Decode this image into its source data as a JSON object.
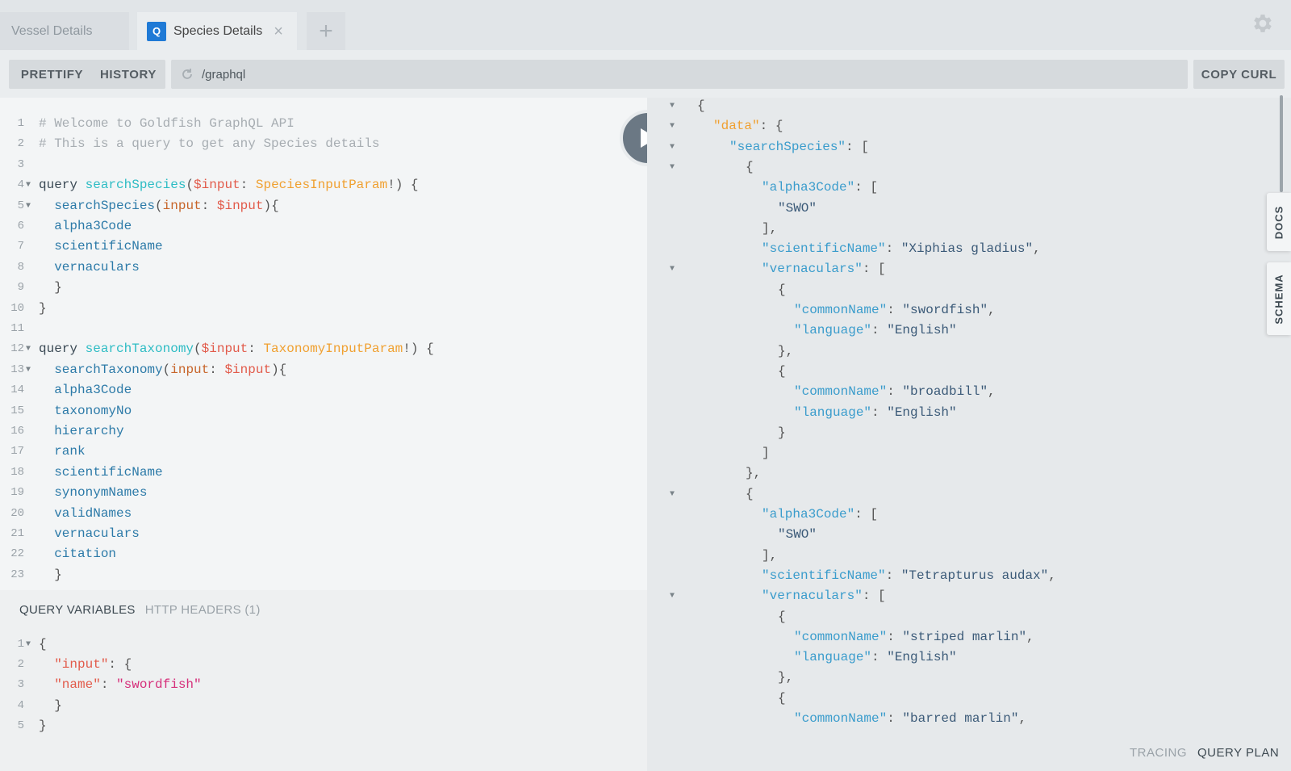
{
  "tabs": [
    {
      "label": "Vessel Details",
      "active": false
    },
    {
      "label": "Species Details",
      "active": true,
      "badge": "Q",
      "close": "×"
    }
  ],
  "tab_add": "+",
  "toolbar": {
    "prettify": "PRETTIFY",
    "history": "HISTORY",
    "url": "/graphql",
    "copy_curl": "COPY CURL"
  },
  "query_lines": [
    [
      {
        "t": "# Welcome to Goldfish GraphQL API",
        "c": "comment"
      }
    ],
    [
      {
        "t": "# This is a query to get any Species details",
        "c": "comment"
      }
    ],
    [],
    [
      {
        "t": "query ",
        "c": "kw"
      },
      {
        "t": "searchSpecies",
        "c": "def"
      },
      {
        "t": "(",
        "c": "punct"
      },
      {
        "t": "$input",
        "c": "var"
      },
      {
        "t": ": ",
        "c": "punct"
      },
      {
        "t": "SpeciesInputParam",
        "c": "type"
      },
      {
        "t": "!) {",
        "c": "punct"
      }
    ],
    [
      {
        "t": "  searchSpecies",
        "c": "field"
      },
      {
        "t": "(",
        "c": "punct"
      },
      {
        "t": "input",
        "c": "arg"
      },
      {
        "t": ": ",
        "c": "punct"
      },
      {
        "t": "$input",
        "c": "var"
      },
      {
        "t": "){",
        "c": "punct"
      }
    ],
    [
      {
        "t": "  alpha3Code",
        "c": "field"
      }
    ],
    [
      {
        "t": "  scientificName",
        "c": "field"
      }
    ],
    [
      {
        "t": "  vernaculars",
        "c": "field"
      }
    ],
    [
      {
        "t": "  }",
        "c": "punct"
      }
    ],
    [
      {
        "t": "}",
        "c": "punct"
      }
    ],
    [],
    [
      {
        "t": "query ",
        "c": "kw"
      },
      {
        "t": "searchTaxonomy",
        "c": "def"
      },
      {
        "t": "(",
        "c": "punct"
      },
      {
        "t": "$input",
        "c": "var"
      },
      {
        "t": ": ",
        "c": "punct"
      },
      {
        "t": "TaxonomyInputParam",
        "c": "type"
      },
      {
        "t": "!) {",
        "c": "punct"
      }
    ],
    [
      {
        "t": "  searchTaxonomy",
        "c": "field"
      },
      {
        "t": "(",
        "c": "punct"
      },
      {
        "t": "input",
        "c": "arg"
      },
      {
        "t": ": ",
        "c": "punct"
      },
      {
        "t": "$input",
        "c": "var"
      },
      {
        "t": "){",
        "c": "punct"
      }
    ],
    [
      {
        "t": "  alpha3Code",
        "c": "field"
      }
    ],
    [
      {
        "t": "  taxonomyNo",
        "c": "field"
      }
    ],
    [
      {
        "t": "  hierarchy",
        "c": "field"
      }
    ],
    [
      {
        "t": "  rank",
        "c": "field"
      }
    ],
    [
      {
        "t": "  scientificName",
        "c": "field"
      }
    ],
    [
      {
        "t": "  synonymNames",
        "c": "field"
      }
    ],
    [
      {
        "t": "  validNames",
        "c": "field"
      }
    ],
    [
      {
        "t": "  vernaculars",
        "c": "field"
      }
    ],
    [
      {
        "t": "  citation",
        "c": "field"
      }
    ],
    [
      {
        "t": "  }",
        "c": "punct"
      }
    ]
  ],
  "query_fold_lines": [
    4,
    5,
    12,
    13
  ],
  "vars_tabs": {
    "query_variables": "QUERY VARIABLES",
    "http_headers": "HTTP HEADERS (1)"
  },
  "var_lines": [
    [
      {
        "t": "{",
        "c": "punct"
      }
    ],
    [
      {
        "t": "  ",
        "c": "punct"
      },
      {
        "t": "\"input\"",
        "c": "key"
      },
      {
        "t": ": {",
        "c": "punct"
      }
    ],
    [
      {
        "t": "  ",
        "c": "punct"
      },
      {
        "t": "\"name\"",
        "c": "key"
      },
      {
        "t": ": ",
        "c": "punct"
      },
      {
        "t": "\"swordfish\"",
        "c": "str"
      }
    ],
    [
      {
        "t": "  }",
        "c": "punct"
      }
    ],
    [
      {
        "t": "}",
        "c": "punct"
      }
    ]
  ],
  "var_fold_lines": [
    1
  ],
  "result_lines": [
    {
      "i": 0,
      "f": true,
      "s": [
        {
          "t": "{",
          "c": "p"
        }
      ]
    },
    {
      "i": 1,
      "f": true,
      "s": [
        {
          "t": "\"data\"",
          "c": "data"
        },
        {
          "t": ": {",
          "c": "p"
        }
      ]
    },
    {
      "i": 2,
      "f": true,
      "s": [
        {
          "t": "\"searchSpecies\"",
          "c": "prop"
        },
        {
          "t": ": [",
          "c": "p"
        }
      ]
    },
    {
      "i": 3,
      "f": true,
      "s": [
        {
          "t": "{",
          "c": "p"
        }
      ]
    },
    {
      "i": 4,
      "f": false,
      "s": [
        {
          "t": "\"alpha3Code\"",
          "c": "prop"
        },
        {
          "t": ": [",
          "c": "p"
        }
      ]
    },
    {
      "i": 5,
      "f": false,
      "s": [
        {
          "t": "\"SWO\"",
          "c": "str"
        }
      ]
    },
    {
      "i": 4,
      "f": false,
      "s": [
        {
          "t": "],",
          "c": "p"
        }
      ]
    },
    {
      "i": 4,
      "f": false,
      "s": [
        {
          "t": "\"scientificName\"",
          "c": "prop"
        },
        {
          "t": ": ",
          "c": "p"
        },
        {
          "t": "\"Xiphias gladius\"",
          "c": "str"
        },
        {
          "t": ",",
          "c": "p"
        }
      ]
    },
    {
      "i": 4,
      "f": true,
      "s": [
        {
          "t": "\"vernaculars\"",
          "c": "prop"
        },
        {
          "t": ": [",
          "c": "p"
        }
      ]
    },
    {
      "i": 5,
      "f": false,
      "s": [
        {
          "t": "{",
          "c": "p"
        }
      ]
    },
    {
      "i": 6,
      "f": false,
      "s": [
        {
          "t": "\"commonName\"",
          "c": "prop"
        },
        {
          "t": ": ",
          "c": "p"
        },
        {
          "t": "\"swordfish\"",
          "c": "str"
        },
        {
          "t": ",",
          "c": "p"
        }
      ]
    },
    {
      "i": 6,
      "f": false,
      "s": [
        {
          "t": "\"language\"",
          "c": "prop"
        },
        {
          "t": ": ",
          "c": "p"
        },
        {
          "t": "\"English\"",
          "c": "str"
        }
      ]
    },
    {
      "i": 5,
      "f": false,
      "s": [
        {
          "t": "},",
          "c": "p"
        }
      ]
    },
    {
      "i": 5,
      "f": false,
      "s": [
        {
          "t": "{",
          "c": "p"
        }
      ]
    },
    {
      "i": 6,
      "f": false,
      "s": [
        {
          "t": "\"commonName\"",
          "c": "prop"
        },
        {
          "t": ": ",
          "c": "p"
        },
        {
          "t": "\"broadbill\"",
          "c": "str"
        },
        {
          "t": ",",
          "c": "p"
        }
      ]
    },
    {
      "i": 6,
      "f": false,
      "s": [
        {
          "t": "\"language\"",
          "c": "prop"
        },
        {
          "t": ": ",
          "c": "p"
        },
        {
          "t": "\"English\"",
          "c": "str"
        }
      ]
    },
    {
      "i": 5,
      "f": false,
      "s": [
        {
          "t": "}",
          "c": "p"
        }
      ]
    },
    {
      "i": 4,
      "f": false,
      "s": [
        {
          "t": "]",
          "c": "p"
        }
      ]
    },
    {
      "i": 3,
      "f": false,
      "s": [
        {
          "t": "},",
          "c": "p"
        }
      ]
    },
    {
      "i": 3,
      "f": true,
      "s": [
        {
          "t": "{",
          "c": "p"
        }
      ]
    },
    {
      "i": 4,
      "f": false,
      "s": [
        {
          "t": "\"alpha3Code\"",
          "c": "prop"
        },
        {
          "t": ": [",
          "c": "p"
        }
      ]
    },
    {
      "i": 5,
      "f": false,
      "s": [
        {
          "t": "\"SWO\"",
          "c": "str"
        }
      ]
    },
    {
      "i": 4,
      "f": false,
      "s": [
        {
          "t": "],",
          "c": "p"
        }
      ]
    },
    {
      "i": 4,
      "f": false,
      "s": [
        {
          "t": "\"scientificName\"",
          "c": "prop"
        },
        {
          "t": ": ",
          "c": "p"
        },
        {
          "t": "\"Tetrapturus audax\"",
          "c": "str"
        },
        {
          "t": ",",
          "c": "p"
        }
      ]
    },
    {
      "i": 4,
      "f": true,
      "s": [
        {
          "t": "\"vernaculars\"",
          "c": "prop"
        },
        {
          "t": ": [",
          "c": "p"
        }
      ]
    },
    {
      "i": 5,
      "f": false,
      "s": [
        {
          "t": "{",
          "c": "p"
        }
      ]
    },
    {
      "i": 6,
      "f": false,
      "s": [
        {
          "t": "\"commonName\"",
          "c": "prop"
        },
        {
          "t": ": ",
          "c": "p"
        },
        {
          "t": "\"striped marlin\"",
          "c": "str"
        },
        {
          "t": ",",
          "c": "p"
        }
      ]
    },
    {
      "i": 6,
      "f": false,
      "s": [
        {
          "t": "\"language\"",
          "c": "prop"
        },
        {
          "t": ": ",
          "c": "p"
        },
        {
          "t": "\"English\"",
          "c": "str"
        }
      ]
    },
    {
      "i": 5,
      "f": false,
      "s": [
        {
          "t": "},",
          "c": "p"
        }
      ]
    },
    {
      "i": 5,
      "f": false,
      "s": [
        {
          "t": "{",
          "c": "p"
        }
      ]
    },
    {
      "i": 6,
      "f": false,
      "s": [
        {
          "t": "\"commonName\"",
          "c": "prop"
        },
        {
          "t": ": ",
          "c": "p"
        },
        {
          "t": "\"barred marlin\"",
          "c": "str"
        },
        {
          "t": ",",
          "c": "p"
        }
      ]
    }
  ],
  "side_tabs": {
    "docs": "DOCS",
    "schema": "SCHEMA"
  },
  "footer": {
    "tracing": "TRACING",
    "query_plan": "QUERY PLAN"
  },
  "icons": {
    "gear": "gear-icon",
    "refresh": "refresh-icon",
    "play": "play-icon",
    "fold": "fold-arrow-icon"
  },
  "colors": {
    "accent": "#1f7ad6",
    "run_button": "#6b7884"
  }
}
